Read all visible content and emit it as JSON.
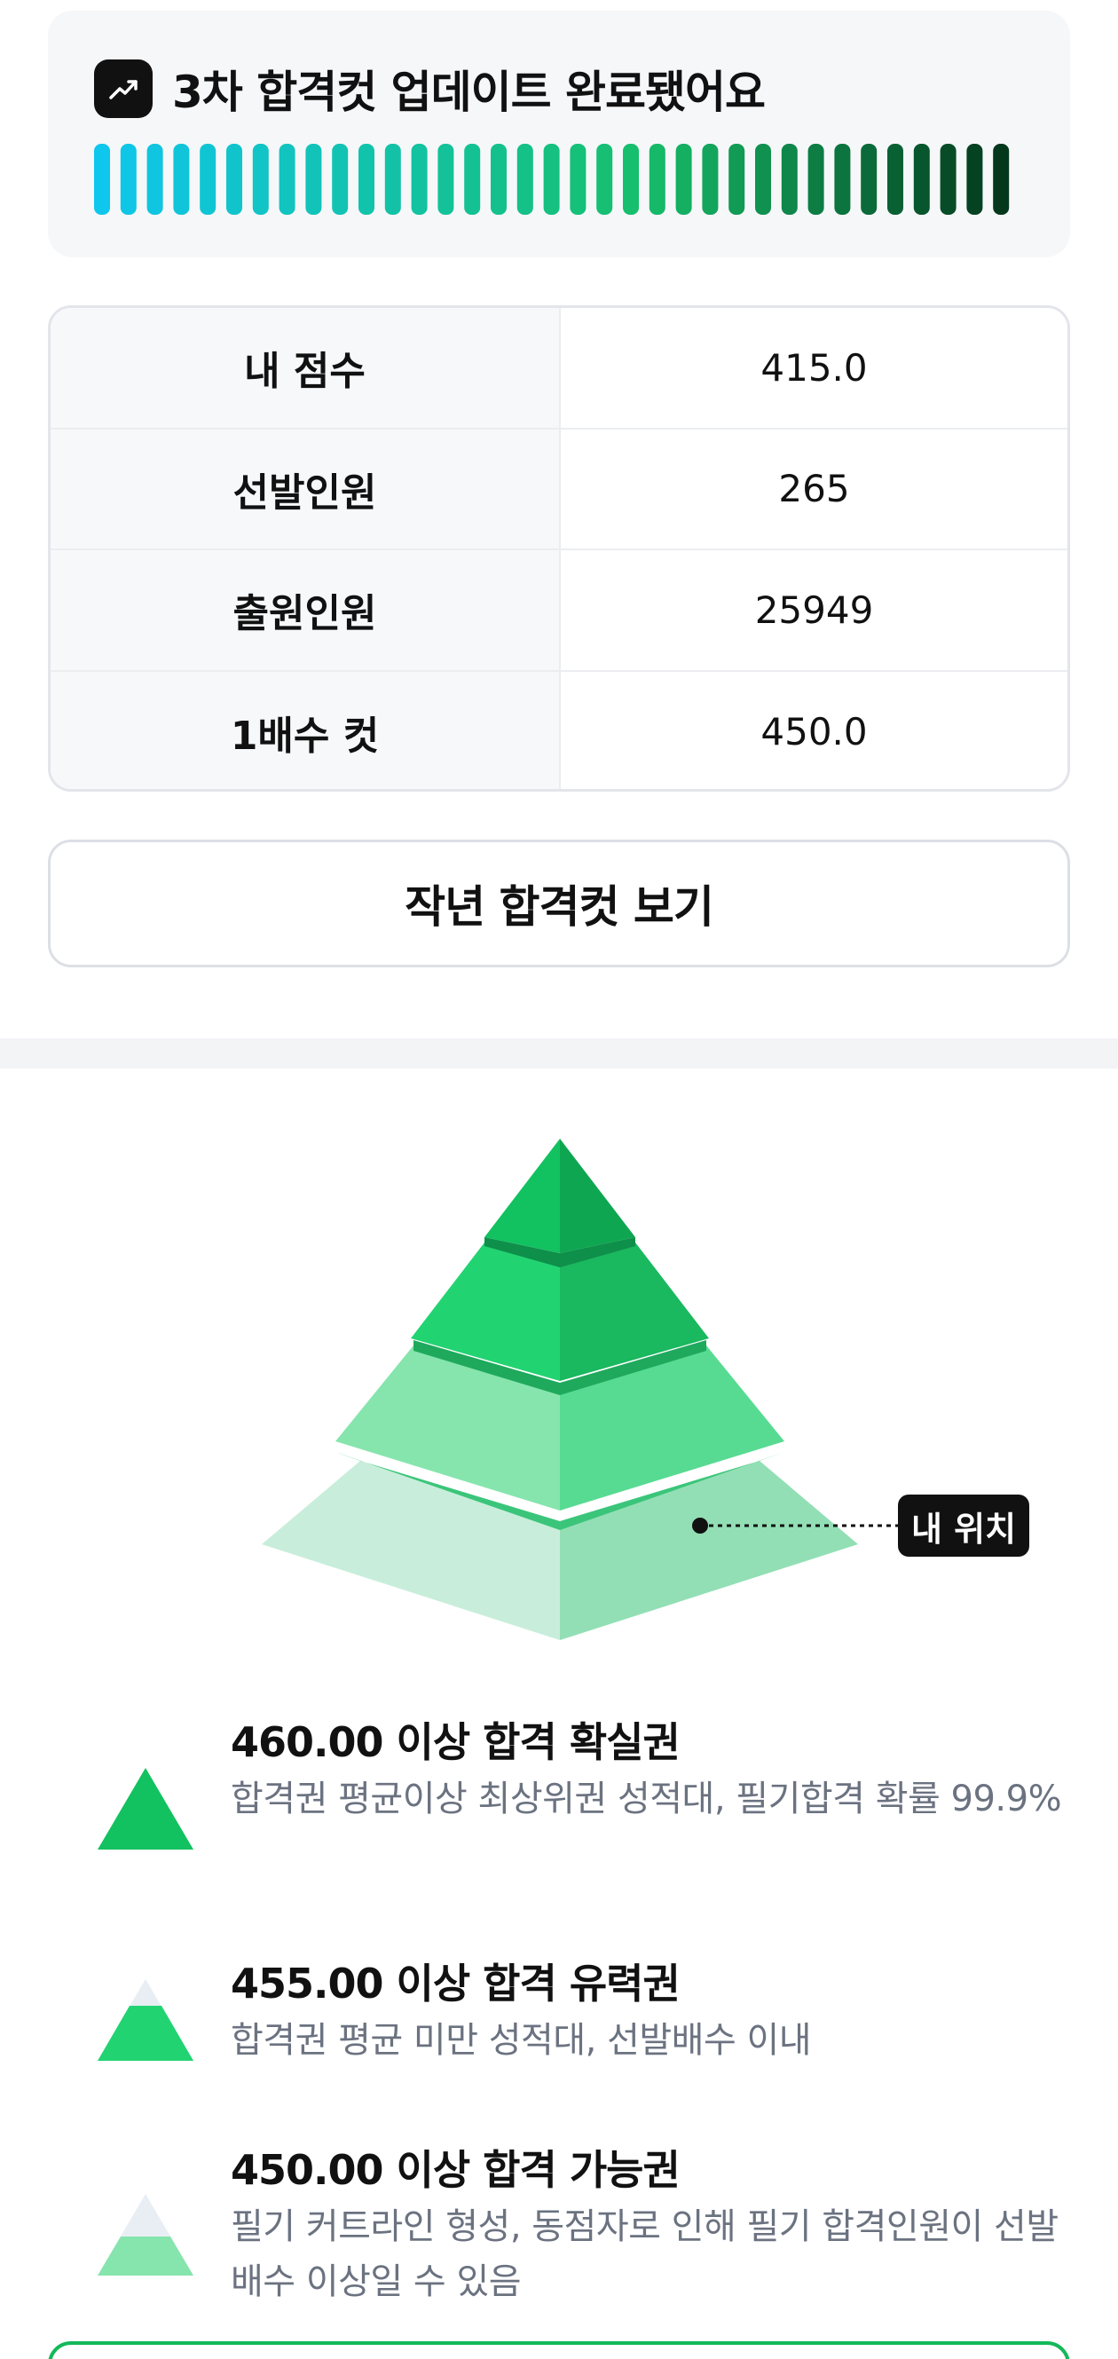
{
  "update": {
    "title": "3차 합격컷 업데이트 완료됐어요",
    "icon": "trend-up-icon",
    "progress_segments": 35,
    "gradient_colors": [
      "#0fc6ec",
      "#16bf6a",
      "#04381c"
    ]
  },
  "info_table": {
    "rows": [
      {
        "label": "내 점수",
        "value": "415.0"
      },
      {
        "label": "선발인원",
        "value": "265"
      },
      {
        "label": "출원인원",
        "value": "25949"
      },
      {
        "label": "1배수 컷",
        "value": "450.0"
      }
    ]
  },
  "prev_cut_button": "작년 합격컷 보기",
  "pyramid": {
    "my_position_label": "내 위치"
  },
  "legend": [
    {
      "title": "460.00 이상 합격 확실권",
      "desc": "합격권 평균이상 최상위권 성적대, 필기합격 확률 99.9%"
    },
    {
      "title": "455.00 이상 합격 유력권",
      "desc": "합격권 평균 미만 성적대, 선발배수 이내"
    },
    {
      "title": "450.00 이상 합격 가능권",
      "desc": "필기 커트라인 형성, 동점자로 인해 필기 합격인원이 선발배수 이상일 수 있음"
    }
  ],
  "colors": {
    "accent": "#14b85a",
    "tier1": "#12c15f",
    "tier2": "#22d372",
    "tier3": "#86e5ad",
    "tier4": "#c8eedb"
  }
}
